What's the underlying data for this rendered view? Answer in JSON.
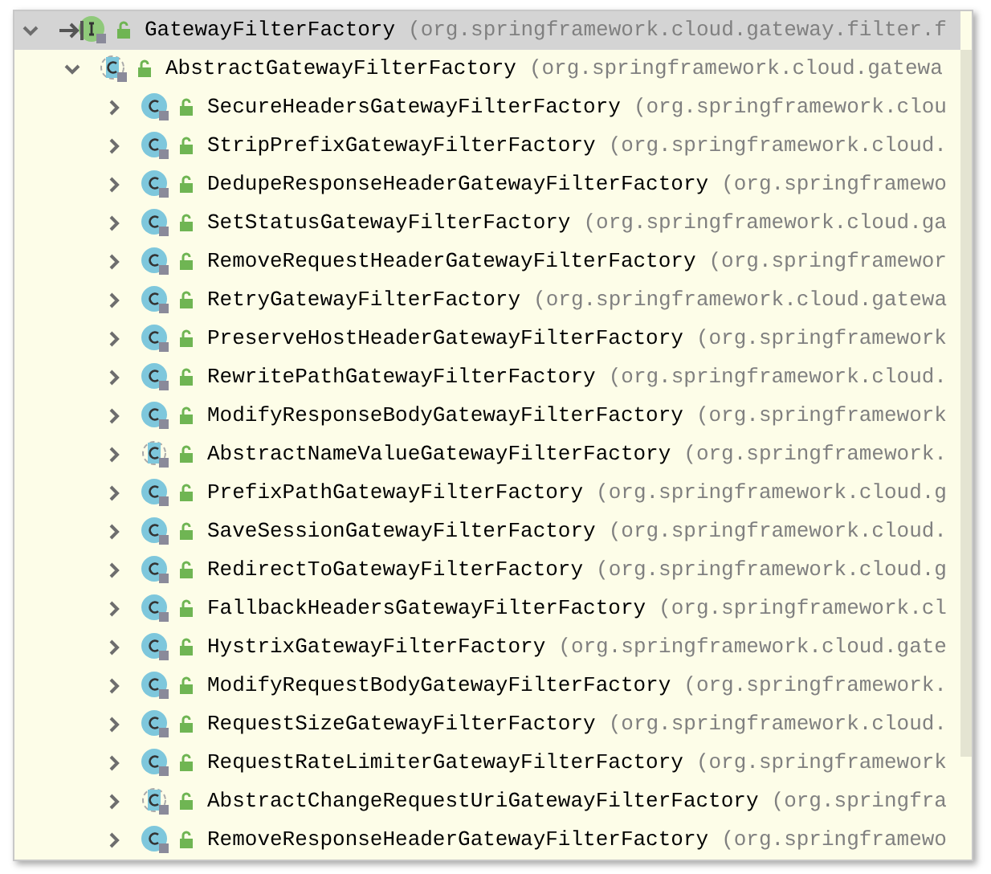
{
  "tree": [
    {
      "name": "GatewayFilterFactory",
      "package": "(org.springframework.cloud.gateway.filter.f",
      "kind": "interface",
      "expanded": true,
      "selected": true,
      "base": true,
      "children": [
        {
          "name": "AbstractGatewayFilterFactory",
          "package": "(org.springframework.cloud.gatewa",
          "kind": "abstract_class",
          "expanded": true,
          "selected": false,
          "children": [
            {
              "name": "SecureHeadersGatewayFilterFactory",
              "package": "(org.springframework.clou",
              "kind": "class",
              "expanded": false,
              "selected": false
            },
            {
              "name": "StripPrefixGatewayFilterFactory",
              "package": "(org.springframework.cloud.",
              "kind": "class",
              "expanded": false,
              "selected": false
            },
            {
              "name": "DedupeResponseHeaderGatewayFilterFactory",
              "package": "(org.springframewo",
              "kind": "class",
              "expanded": false,
              "selected": false
            },
            {
              "name": "SetStatusGatewayFilterFactory",
              "package": "(org.springframework.cloud.ga",
              "kind": "class",
              "expanded": false,
              "selected": false
            },
            {
              "name": "RemoveRequestHeaderGatewayFilterFactory",
              "package": "(org.springframewor",
              "kind": "class",
              "expanded": false,
              "selected": false
            },
            {
              "name": "RetryGatewayFilterFactory",
              "package": "(org.springframework.cloud.gatewa",
              "kind": "class",
              "expanded": false,
              "selected": false
            },
            {
              "name": "PreserveHostHeaderGatewayFilterFactory",
              "package": "(org.springframework",
              "kind": "class",
              "expanded": false,
              "selected": false
            },
            {
              "name": "RewritePathGatewayFilterFactory",
              "package": "(org.springframework.cloud.",
              "kind": "class",
              "expanded": false,
              "selected": false
            },
            {
              "name": "ModifyResponseBodyGatewayFilterFactory",
              "package": "(org.springframework",
              "kind": "class",
              "expanded": false,
              "selected": false
            },
            {
              "name": "AbstractNameValueGatewayFilterFactory",
              "package": "(org.springframework.",
              "kind": "abstract_class",
              "expanded": false,
              "selected": false
            },
            {
              "name": "PrefixPathGatewayFilterFactory",
              "package": "(org.springframework.cloud.g",
              "kind": "class",
              "expanded": false,
              "selected": false
            },
            {
              "name": "SaveSessionGatewayFilterFactory",
              "package": "(org.springframework.cloud.",
              "kind": "class",
              "expanded": false,
              "selected": false
            },
            {
              "name": "RedirectToGatewayFilterFactory",
              "package": "(org.springframework.cloud.g",
              "kind": "class",
              "expanded": false,
              "selected": false
            },
            {
              "name": "FallbackHeadersGatewayFilterFactory",
              "package": "(org.springframework.cl",
              "kind": "class",
              "expanded": false,
              "selected": false
            },
            {
              "name": "HystrixGatewayFilterFactory",
              "package": "(org.springframework.cloud.gate",
              "kind": "class",
              "expanded": false,
              "selected": false
            },
            {
              "name": "ModifyRequestBodyGatewayFilterFactory",
              "package": "(org.springframework.",
              "kind": "class",
              "expanded": false,
              "selected": false
            },
            {
              "name": "RequestSizeGatewayFilterFactory",
              "package": "(org.springframework.cloud.",
              "kind": "class",
              "expanded": false,
              "selected": false
            },
            {
              "name": "RequestRateLimiterGatewayFilterFactory",
              "package": "(org.springframework",
              "kind": "class",
              "expanded": false,
              "selected": false
            },
            {
              "name": "AbstractChangeRequestUriGatewayFilterFactory",
              "package": "(org.springfra",
              "kind": "abstract_class",
              "expanded": false,
              "selected": false
            },
            {
              "name": "RemoveResponseHeaderGatewayFilterFactory",
              "package": "(org.springframewo",
              "kind": "class",
              "expanded": false,
              "selected": false
            }
          ]
        }
      ]
    }
  ]
}
